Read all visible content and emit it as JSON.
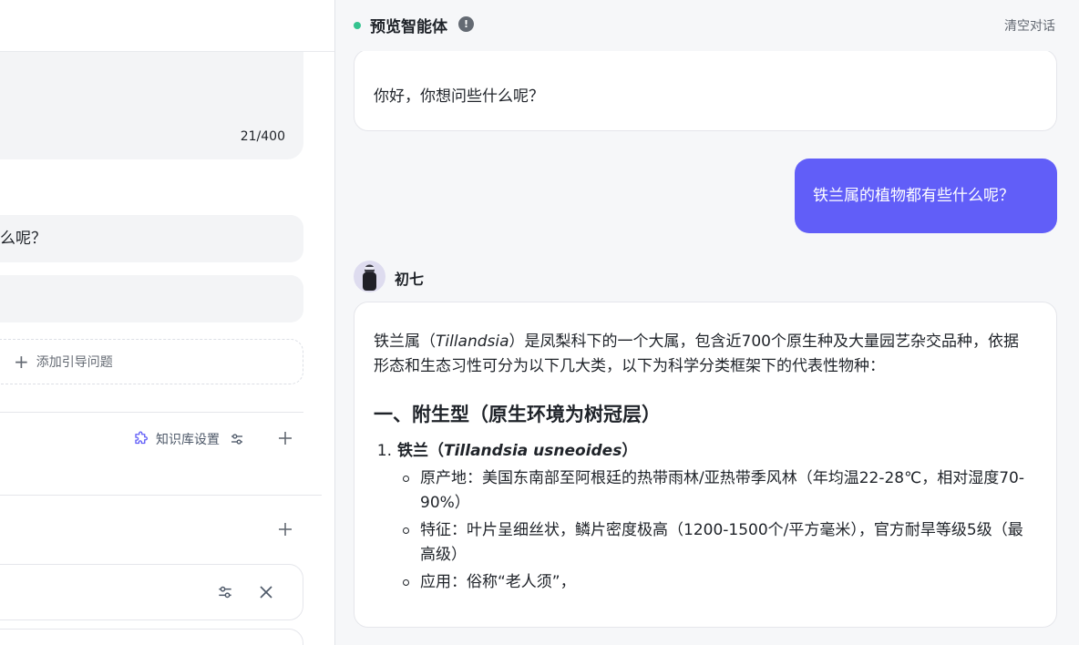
{
  "left_panel": {
    "prompt_char_count": "21/400",
    "preset_questions": [
      "么呢？",
      ""
    ],
    "add_question_label": "添加引导问题",
    "knowledge_base_settings_label": "知识库设置"
  },
  "chat": {
    "title": "预览智能体",
    "info_icon": "!",
    "clear_label": "清空对话",
    "status_color": "#34c38f",
    "accent_color": "#615ef8",
    "greeting": "你好，你想问些什么呢？",
    "user_message": "铁兰属的植物都有些什么呢？",
    "bot_name": "初七",
    "answer": {
      "intro_before": "铁兰属（",
      "intro_italic": "Tillandsia",
      "intro_after": "）是凤梨科下的一个大属，包含近700个原生种及大量园艺杂交品种，依据形态和生态习性可分为以下几大类，以下为科学分类框架下的代表性物种：",
      "heading": "一、附生型（原生环境为树冠层）",
      "items": [
        {
          "number": "1.",
          "title_before": "铁兰（",
          "title_italic": "Tillandsia usneoides",
          "title_after": "）",
          "bullets": [
            "原产地：美国东南部至阿根廷的热带雨林/亚热带季风林（年均温22-28℃，相对湿度70-90%）",
            "特征：叶片呈细丝状，鳞片密度极高（1200-1500个/平方毫米），官方耐旱等级5级（最高级）",
            "应用：俗称“老人须”，"
          ]
        }
      ]
    }
  }
}
